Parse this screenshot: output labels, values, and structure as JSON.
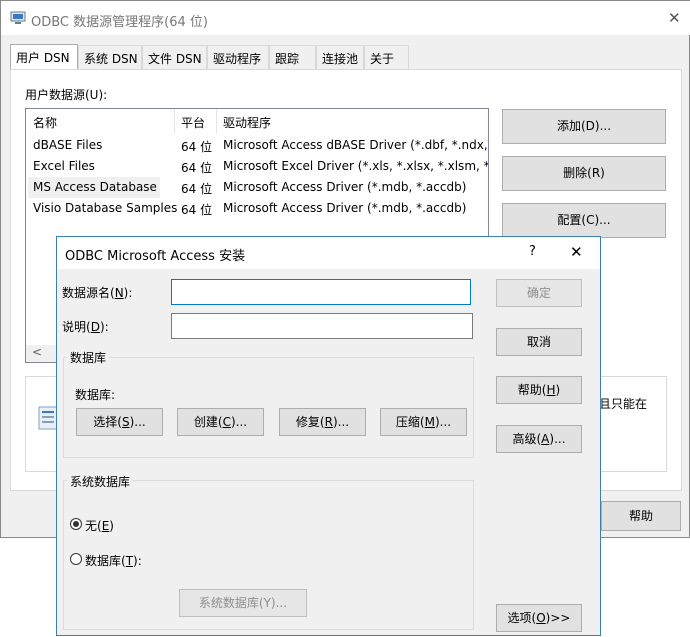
{
  "main": {
    "title": "ODBC 数据源管理程序(64 位)",
    "close_glyph": "✕",
    "tabs": [
      {
        "label": "用户 DSN"
      },
      {
        "label": "系统 DSN"
      },
      {
        "label": "文件 DSN"
      },
      {
        "label": "驱动程序"
      },
      {
        "label": "跟踪"
      },
      {
        "label": "连接池"
      },
      {
        "label": "关于"
      }
    ],
    "list_label": "用户数据源(U):",
    "columns": [
      "名称",
      "平台",
      "驱动程序"
    ],
    "rows": [
      {
        "name": "dBASE Files",
        "platform": "64 位",
        "driver": "Microsoft Access dBASE Driver (*.dbf, *.ndx, *"
      },
      {
        "name": "Excel Files",
        "platform": "64 位",
        "driver": "Microsoft Excel Driver (*.xls, *.xlsx, *.xlsm, *.xls"
      },
      {
        "name": "MS Access Database",
        "platform": "64 位",
        "driver": "Microsoft Access Driver (*.mdb, *.accdb)"
      },
      {
        "name": "Visio Database Samples",
        "platform": "64 位",
        "driver": "Microsoft Access Driver (*.mdb, *.accdb)"
      }
    ],
    "buttons": {
      "add": "添加(D)...",
      "remove": "删除(R)",
      "config": "配置(C)...",
      "help": "帮助"
    },
    "info_partial": "且只能在",
    "scroll_left": "<"
  },
  "dialog": {
    "title": "ODBC Microsoft Access 安装",
    "help_glyph": "?",
    "close_glyph": "✕",
    "dsn_label": {
      "pre": "数据源名(",
      "key": "N",
      "post": "):"
    },
    "desc_label": {
      "pre": "说明(",
      "key": "D",
      "post": "):"
    },
    "dsn_value": "",
    "desc_value": "",
    "db_group": "数据库",
    "db_label": "数据库:",
    "db_buttons": [
      {
        "pre": "选择(",
        "key": "S",
        "post": ")..."
      },
      {
        "pre": "创建(",
        "key": "C",
        "post": ")..."
      },
      {
        "pre": "修复(",
        "key": "R",
        "post": ")..."
      },
      {
        "pre": "压缩(",
        "key": "M",
        "post": ")..."
      }
    ],
    "sysdb_group": "系统数据库",
    "radio_none": {
      "pre": "无(",
      "key": "E",
      "post": ")"
    },
    "radio_db": {
      "pre": "数据库(",
      "key": "T",
      "post": "):"
    },
    "sysdb_button": "系统数据库(Y)...",
    "right_buttons": {
      "ok": "确定",
      "cancel": "取消",
      "help": {
        "pre": "帮助(",
        "key": "H",
        "post": ")"
      },
      "advanced": {
        "pre": "高级(",
        "key": "A",
        "post": ")..."
      },
      "options": {
        "pre": "选项(",
        "key": "O",
        "post": ")>>"
      }
    }
  }
}
